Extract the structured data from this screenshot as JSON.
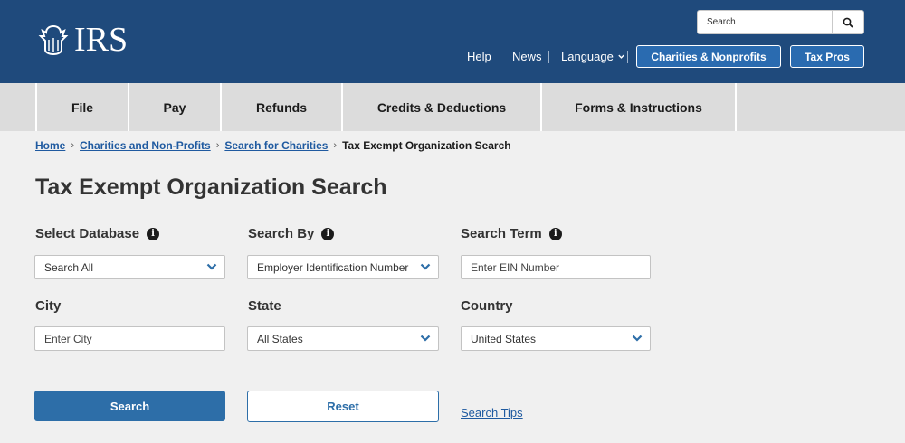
{
  "header": {
    "logo_text": "IRS",
    "search_placeholder": "Search",
    "utility_links": {
      "help": "Help",
      "news": "News",
      "language": "Language"
    },
    "buttons": {
      "charities": "Charities & Nonprofits",
      "tax_pros": "Tax Pros"
    }
  },
  "main_nav": {
    "tabs": [
      {
        "label": "File"
      },
      {
        "label": "Pay"
      },
      {
        "label": "Refunds"
      },
      {
        "label": "Credits & Deductions"
      },
      {
        "label": "Forms & Instructions"
      }
    ]
  },
  "breadcrumb": {
    "items": [
      "Home",
      "Charities and Non-Profits",
      "Search for Charities"
    ],
    "current": "Tax Exempt Organization Search"
  },
  "page": {
    "title": "Tax Exempt Organization Search"
  },
  "form": {
    "database": {
      "label": "Select Database",
      "value": "Search All"
    },
    "search_by": {
      "label": "Search By",
      "value": "Employer Identification Number"
    },
    "search_term": {
      "label": "Search Term",
      "placeholder": "Enter EIN Number"
    },
    "city": {
      "label": "City",
      "placeholder": "Enter City"
    },
    "state": {
      "label": "State",
      "value": "All States"
    },
    "country": {
      "label": "Country",
      "value": "United States"
    },
    "search_button": "Search",
    "reset_button": "Reset",
    "tips_link": "Search Tips"
  },
  "colors": {
    "header_bg": "#1f4a7c",
    "accent": "#2d6ea8",
    "nav_bg": "#dcdcdc",
    "page_bg": "#f0f0f0"
  }
}
